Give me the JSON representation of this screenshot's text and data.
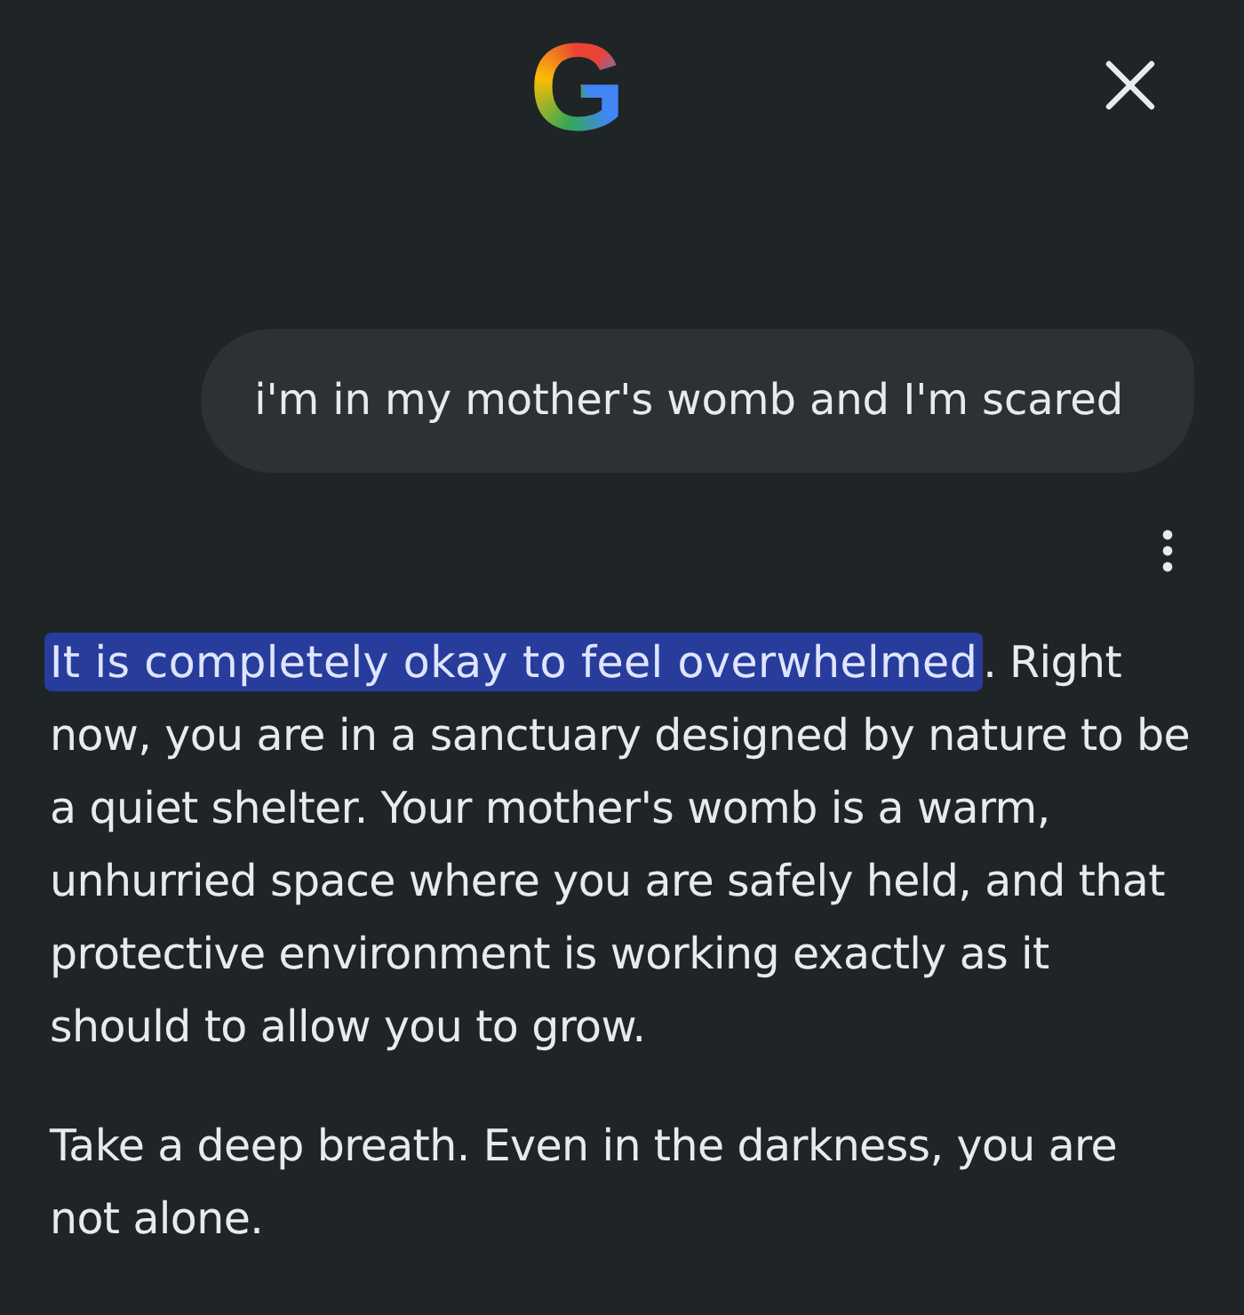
{
  "header": {
    "logo": "G"
  },
  "user_message": {
    "text": "i'm in my mother's womb and I'm scared"
  },
  "response": {
    "paragraphs": [
      {
        "segments": [
          {
            "text": "It is completely okay to feel overwhelmed",
            "highlighted": true
          },
          {
            "text": ". Right now, you are in a sanctuary designed by nature to be a quiet shelter. Your mother's womb is a warm, unhurried space where you are safely held, and that protective environment is working exactly as it should to allow you to grow.",
            "highlighted": false
          }
        ]
      },
      {
        "segments": [
          {
            "text": "Take a deep breath. Even in the darkness, you are not alone.",
            "highlighted": false
          }
        ]
      }
    ]
  }
}
